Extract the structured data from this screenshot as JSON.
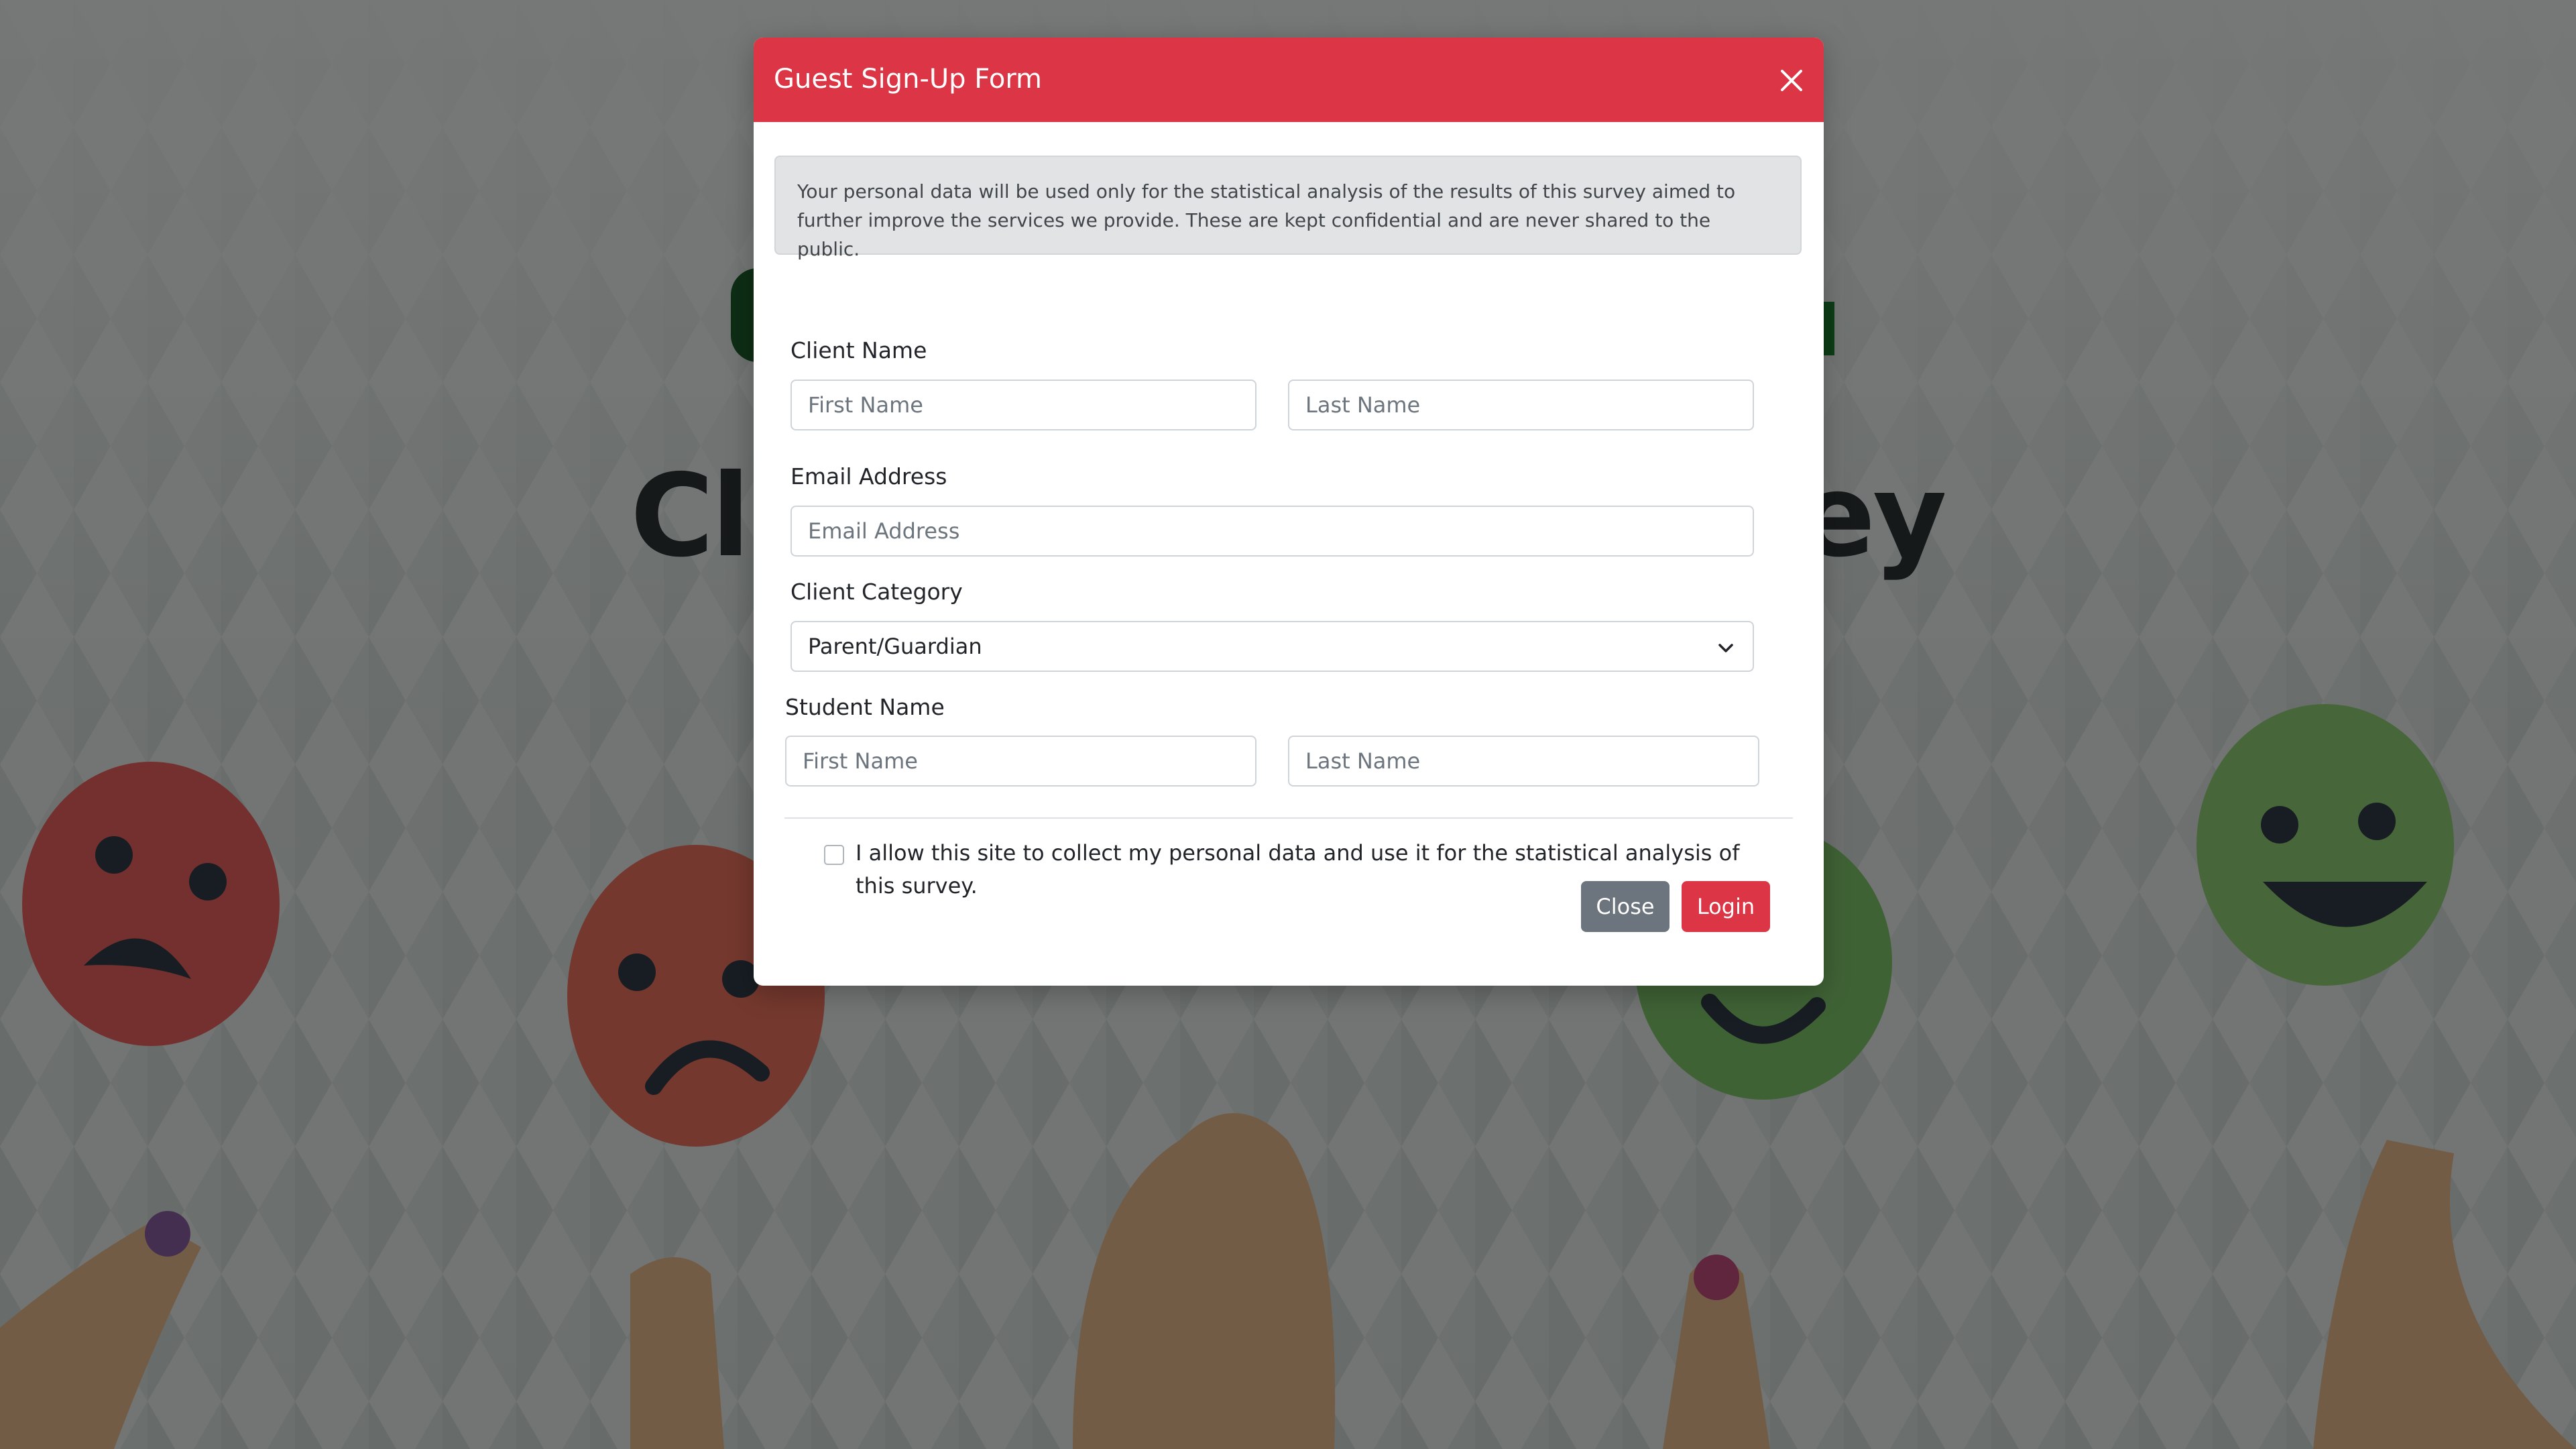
{
  "background": {
    "title_left": "Cli",
    "title_right": "ey"
  },
  "modal": {
    "title": "Guest Sign-Up Form",
    "close_icon": "close-icon",
    "notice": "Your personal data will be used only for the statistical analysis of the results of this survey aimed to further improve the services we provide. These are kept confidential and are never shared to the public.",
    "client_name": {
      "label": "Client Name",
      "first_placeholder": "First Name",
      "last_placeholder": "Last Name"
    },
    "email": {
      "label": "Email Address",
      "placeholder": "Email Address"
    },
    "client_category": {
      "label": "Client Category",
      "selected": "Parent/Guardian"
    },
    "student_name": {
      "label": "Student Name",
      "first_placeholder": "First Name",
      "last_placeholder": "Last Name"
    },
    "consent": {
      "text": "I allow this site to collect my personal data and use it for the statistical analysis of this survey.",
      "checked": false
    },
    "buttons": {
      "close": "Close",
      "login": "Login"
    }
  },
  "colors": {
    "header": "#dc3545",
    "login_button": "#dc3545",
    "close_button": "#6c757d",
    "notice_bg": "#e2e3e5"
  }
}
